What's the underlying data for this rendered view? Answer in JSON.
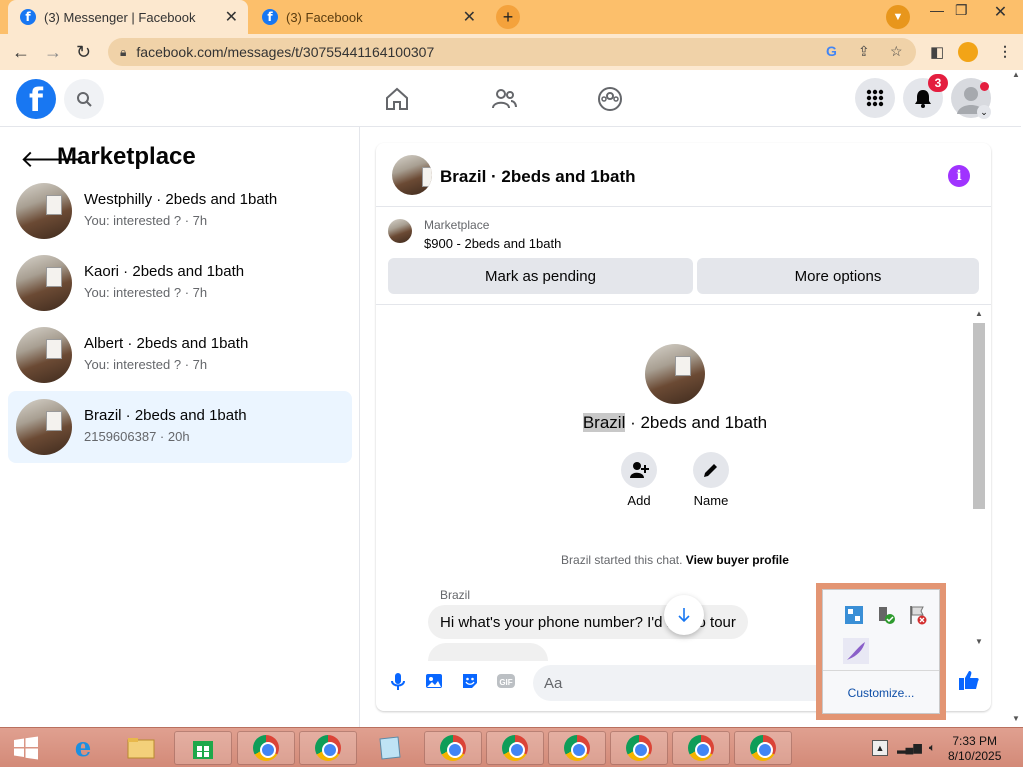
{
  "browser": {
    "tabs": [
      {
        "label": "(3) Messenger | Facebook",
        "active": true
      },
      {
        "label": "(3) Facebook",
        "active": false
      }
    ],
    "url": "facebook.com/messages/t/30755441164100307",
    "window_controls": {
      "minimize": "—",
      "restore": "❐",
      "close": "✕"
    }
  },
  "header": {
    "notification_count": "3"
  },
  "sidebar": {
    "title": "Marketplace",
    "conversations": [
      {
        "name": "Westphilly · 2beds and 1bath",
        "sub": "You: interested ? · 7h",
        "selected": false
      },
      {
        "name": "Kaori · 2beds and 1bath",
        "sub": "You: interested ? · 7h",
        "selected": false
      },
      {
        "name": "Albert · 2beds and 1bath",
        "sub": "You: interested ? · 7h",
        "selected": false
      },
      {
        "name": "Brazil · 2beds and 1bath",
        "sub": "2159606387 · 20h",
        "selected": true
      }
    ]
  },
  "chat": {
    "title": "Brazil · 2beds and 1bath",
    "listing_label": "Marketplace",
    "listing_price": "$900 - 2beds and 1bath",
    "mark_pending": "Mark as pending",
    "more_options": "More options",
    "center_name_highlight": "Brazil",
    "center_name_rest": " · 2beds and 1bath",
    "add_label": "Add",
    "name_label": "Name",
    "system_msg": "Brazil started this chat.",
    "view_buyer": "View buyer profile",
    "sender": "Brazil",
    "message": "Hi what's your phone number? I'd like to tour",
    "input_placeholder": "Aa"
  },
  "tray_popup": {
    "customize": "Customize..."
  },
  "taskbar": {
    "time": "7:33 PM",
    "date": "8/10/2025"
  }
}
